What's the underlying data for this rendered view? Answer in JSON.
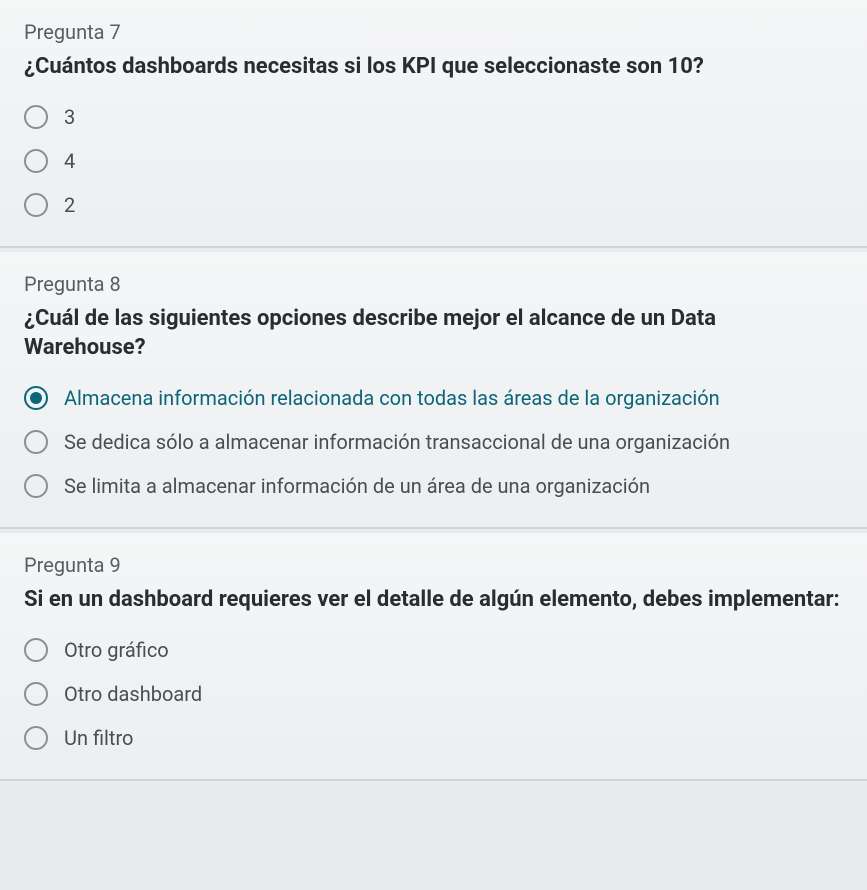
{
  "questions": [
    {
      "label": "Pregunta 7",
      "text": "¿Cuántos dashboards necesitas si los KPI que seleccionaste son 10?",
      "options": [
        {
          "text": "3",
          "selected": false
        },
        {
          "text": "4",
          "selected": false
        },
        {
          "text": "2",
          "selected": false
        }
      ]
    },
    {
      "label": "Pregunta 8",
      "text": "¿Cuál de las siguientes opciones describe mejor el alcance de un Data Warehouse?",
      "options": [
        {
          "text": "Almacena información relacionada con todas las áreas de la organización",
          "selected": true
        },
        {
          "text": "Se dedica sólo a almacenar información transaccional de una organización",
          "selected": false
        },
        {
          "text": "Se limita a almacenar información de un área de una organización",
          "selected": false
        }
      ]
    },
    {
      "label": "Pregunta 9",
      "text": "Si en un dashboard requieres ver el detalle de algún elemento, debes implementar:",
      "options": [
        {
          "text": "Otro gráfico",
          "selected": false
        },
        {
          "text": "Otro dashboard",
          "selected": false
        },
        {
          "text": "Un filtro",
          "selected": false
        }
      ]
    }
  ]
}
